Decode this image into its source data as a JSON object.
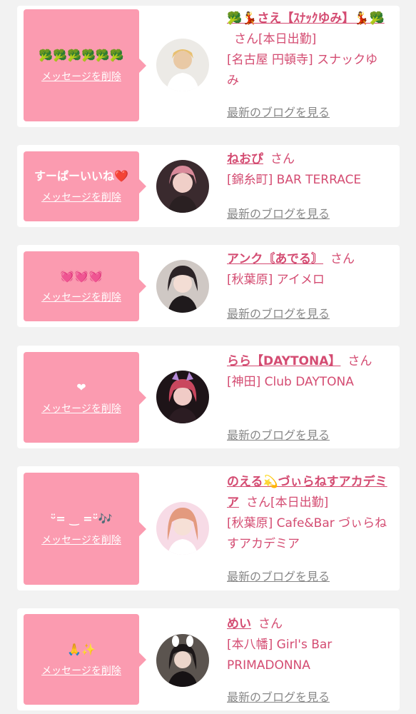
{
  "delete_label": "メッセージを削除",
  "blog_label": "最新のブログを見る",
  "colors": {
    "bubble": "#fb9bb0",
    "name": "#d44c72",
    "link": "#888888",
    "background": "#f2f2f2"
  },
  "entries": [
    {
      "message": "🥦🥦🥦🥦🥦🥦",
      "name": "🥦💃さえ【ｽﾅｯｸゆみ】💃🥦",
      "honorific": "さん",
      "status": "[本日出勤]",
      "shop": "[名古屋 円頓寺] スナックゆみ"
    },
    {
      "message": "すーぱーいいね❤️",
      "name": "ねおぴ",
      "honorific": "さん",
      "status": "",
      "shop": "[錦糸町] BAR TERRACE"
    },
    {
      "message": "💓💓💓",
      "name": "アンク〘あでる〙",
      "honorific": "さん",
      "status": "",
      "shop": "[秋葉原] アイメロ"
    },
    {
      "message": "❤",
      "name": "らら【DAYTONA】",
      "honorific": "さん",
      "status": "",
      "shop": "[神田] Club DAYTONA"
    },
    {
      "message": "ᵕ̈= ‿ =ᵕ̈🎶",
      "name": "のえる💫づぃらねすアカデミア",
      "honorific": "さん",
      "status": "[本日出勤]",
      "shop": "[秋葉原] Cafe&Bar づぃらねすアカデミア"
    },
    {
      "message": "🙏✨",
      "name": "めい",
      "honorific": "さん",
      "status": "",
      "shop": "[本八幡] Girl's Bar PRIMADONNA"
    }
  ]
}
